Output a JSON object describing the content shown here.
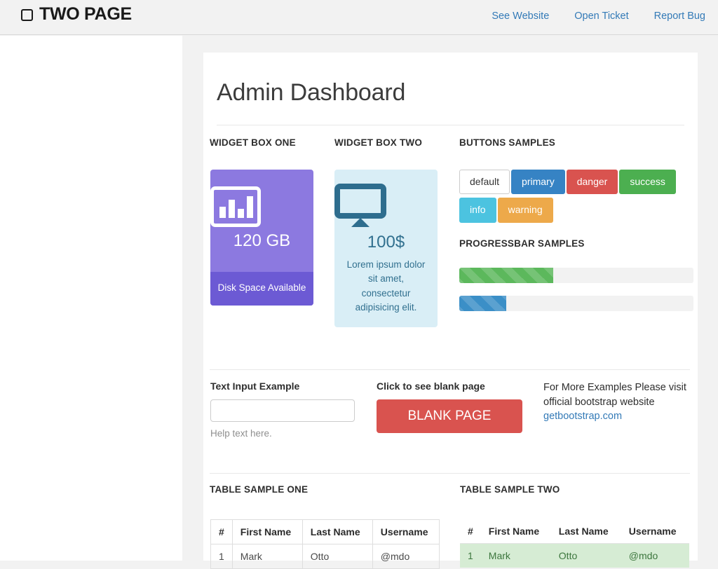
{
  "navbar": {
    "brand": "TWO PAGE",
    "brand_icon": "rounded-square-icon",
    "links": [
      {
        "label": "See Website"
      },
      {
        "label": "Open Ticket"
      },
      {
        "label": "Report Bug"
      }
    ],
    "link_color": "#337ab7"
  },
  "page": {
    "title": "Admin Dashboard"
  },
  "widgets": {
    "one": {
      "label": "WIDGET BOX ONE",
      "icon": "bar-chart-icon",
      "value": "120 GB",
      "footer": "Disk Space Available",
      "bg_color": "#8c79e0",
      "footer_color": "#6c5ad4"
    },
    "two": {
      "label": "WIDGET BOX TWO",
      "icon": "desktop-monitor-icon",
      "value": "100$",
      "text": "Lorem ipsum dolor sit amet, consectetur adipisicing elit.",
      "bg_color": "#d9eef6",
      "text_color": "#31708f"
    }
  },
  "buttons": {
    "label": "BUTTONS SAMPLES",
    "items": [
      {
        "label": "default",
        "color": "#ffffff"
      },
      {
        "label": "primary",
        "color": "#3683c4"
      },
      {
        "label": "danger",
        "color": "#d9534f"
      },
      {
        "label": "success",
        "color": "#4caf50"
      },
      {
        "label": "info",
        "color": "#4cc3e0"
      },
      {
        "label": "warning",
        "color": "#eda94a"
      }
    ]
  },
  "progress": {
    "label": "PROGRESSBAR SAMPLES",
    "bars": [
      {
        "style": "success",
        "percent": 40,
        "color": "#5cb85c"
      },
      {
        "style": "info",
        "percent": 20,
        "color": "#3b8fc7"
      }
    ]
  },
  "form_row": {
    "input": {
      "label": "Text Input Example",
      "value": "",
      "placeholder": "",
      "help_text": "Help text here."
    },
    "blank": {
      "label": "Click to see blank page",
      "button_label": "BLANK PAGE",
      "button_color": "#d9534f"
    },
    "more": {
      "text": "For More Examples Please visit official bootstrap website ",
      "link_label": "getbootstrap.com"
    }
  },
  "tables": {
    "one": {
      "label": "TABLE SAMPLE ONE",
      "columns": [
        "#",
        "First Name",
        "Last Name",
        "Username"
      ],
      "rows": [
        [
          "1",
          "Mark",
          "Otto",
          "@mdo"
        ]
      ]
    },
    "two": {
      "label": "TABLE SAMPLE TWO",
      "columns": [
        "#",
        "First Name",
        "Last Name",
        "Username"
      ],
      "rows": [
        {
          "cells": [
            "1",
            "Mark",
            "Otto",
            "@mdo"
          ],
          "state": "success"
        }
      ],
      "success_bg": "#d6ecd4"
    }
  }
}
